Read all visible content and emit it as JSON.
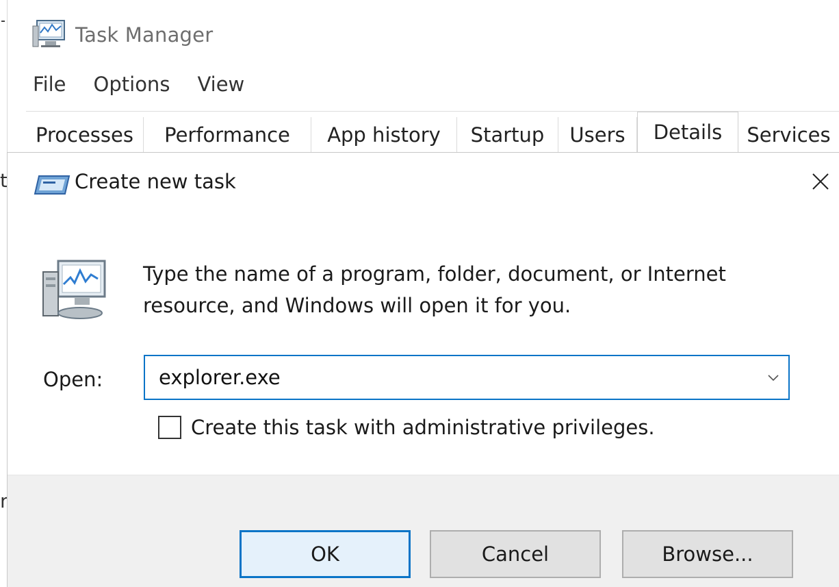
{
  "task_manager": {
    "title": "Task Manager",
    "menu": [
      "File",
      "Options",
      "View"
    ],
    "tabs": [
      "Processes",
      "Performance",
      "App history",
      "Startup",
      "Users",
      "Details",
      "Services"
    ],
    "active_tab": "Details",
    "left_edge_glyphs": [
      "t",
      "n"
    ]
  },
  "dialog": {
    "title": "Create new task",
    "description": "Type the name of a program, folder, document, or Internet resource, and Windows will open it for you.",
    "open_label": "Open:",
    "open_value": "explorer.exe",
    "admin_checkbox_label": "Create this task with administrative privileges.",
    "admin_checked": false,
    "buttons": {
      "ok": "OK",
      "cancel": "Cancel",
      "browse": "Browse..."
    }
  },
  "colors": {
    "accent": "#0a74c7",
    "footer_bg": "#f0f0f0",
    "button_bg": "#e1e1e1"
  },
  "icons": {
    "app": "task-manager-icon",
    "dialog_title": "run-window-icon",
    "dialog_large": "task-manager-large-icon",
    "close": "close-icon",
    "dropdown": "chevron-down-icon"
  }
}
